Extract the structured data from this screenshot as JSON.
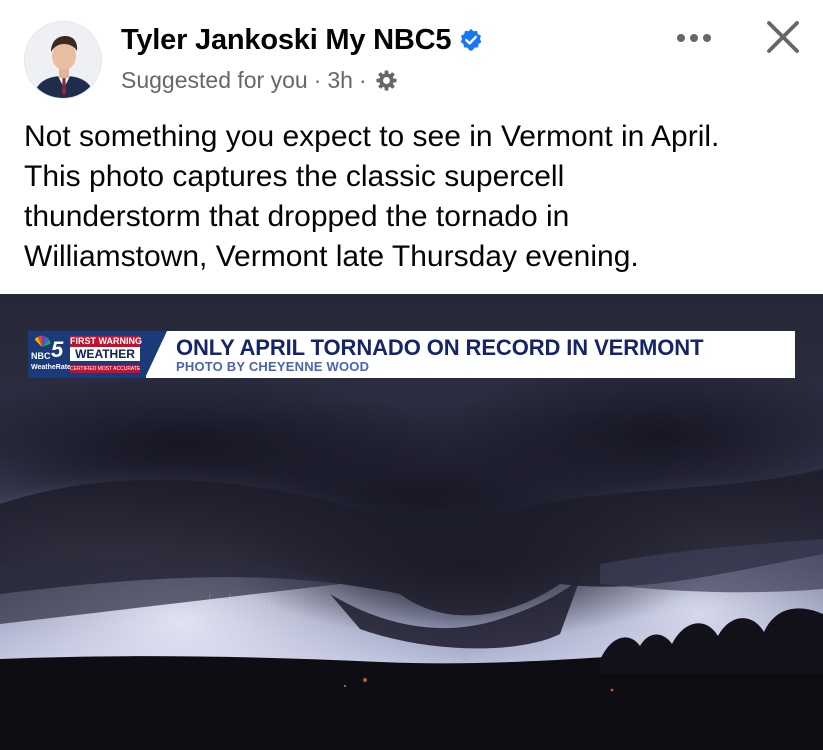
{
  "post": {
    "author": "Tyler Jankoski My NBC5",
    "meta_suggested": "Suggested for you",
    "meta_dot": "·",
    "meta_time": "3h",
    "text_lines": [
      "Not something you expect to see in Vermont in April.",
      "This photo captures the classic supercell",
      "thunderstorm that dropped the tornado in",
      "Williamstown, Vermont late Thursday evening."
    ]
  },
  "icons": {
    "verified": "verified-badge-icon",
    "audience": "gear-icon",
    "more": "more-options-icon",
    "close": "close-icon"
  },
  "photo": {
    "lower_third": {
      "station_number": "5",
      "nbc": "NBC",
      "first_warning": "FIRST WARNING",
      "weather": "WEATHER",
      "weatherate": "WeatheRate",
      "tag": "CERTIFIED MOST ACCURATE",
      "headline": "ONLY APRIL TORNADO ON RECORD IN VERMONT",
      "credit": "PHOTO BY CHEYENNE WOOD"
    }
  },
  "colors": {
    "verified_blue": "#1877f2",
    "secondary_text": "#65676b",
    "headline_navy": "#16246a",
    "station_navy": "#1a3a7a",
    "station_red": "#c8102e"
  }
}
